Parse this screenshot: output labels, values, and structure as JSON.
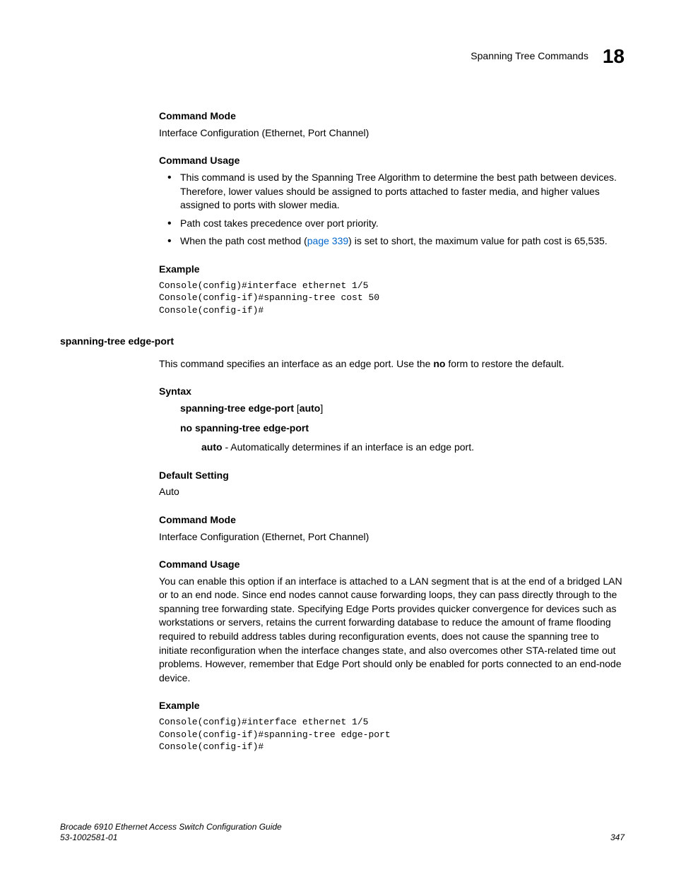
{
  "header": {
    "title": "Spanning Tree Commands",
    "chapter": "18"
  },
  "section1": {
    "h_mode": "Command Mode",
    "mode_text": "Interface Configuration (Ethernet, Port Channel)",
    "h_usage": "Command Usage",
    "usage_b1": "This command is used by the Spanning Tree Algorithm to determine the best path between devices. Therefore, lower values should be assigned to ports attached to faster media, and higher values assigned to ports with slower media.",
    "usage_b2": "Path cost takes precedence over port priority.",
    "usage_b3_a": "When the path cost method (",
    "usage_b3_link": "page 339",
    "usage_b3_b": ") is set to short, the maximum value for path cost is 65,535.",
    "h_example": "Example",
    "example_code": "Console(config)#interface ethernet 1/5\nConsole(config-if)#spanning-tree cost 50\nConsole(config-if)#"
  },
  "command2": {
    "title": "spanning-tree edge-port",
    "intro_a": "This command specifies an interface as an edge port. Use the ",
    "intro_bold": "no",
    "intro_b": " form to restore the default.",
    "h_syntax": "Syntax",
    "syntax_l1_bold": "spanning-tree edge-port",
    "syntax_l1_rest": " [",
    "syntax_l1_bold2": "auto",
    "syntax_l1_rest2": "]",
    "syntax_l2": "no spanning-tree edge-port",
    "syntax_param_bold": "auto",
    "syntax_param_rest": " - Automatically determines if an interface is an edge port.",
    "h_default": "Default Setting",
    "default_text": "Auto",
    "h_mode": "Command Mode",
    "mode_text": "Interface Configuration (Ethernet, Port Channel)",
    "h_usage": "Command Usage",
    "usage_text": "You can enable this option if an interface is attached to a LAN segment that is at the end of a bridged LAN or to an end node. Since end nodes cannot cause forwarding loops, they can pass directly through to the spanning tree forwarding state. Specifying Edge Ports provides quicker convergence for devices such as workstations or servers, retains the current forwarding database to reduce the amount of frame flooding required to rebuild address tables during reconfiguration events, does not cause the spanning tree to initiate reconfiguration when the interface changes state, and also overcomes other STA-related time out problems. However, remember that Edge Port should only be enabled for ports connected to an end-node device.",
    "h_example": "Example",
    "example_code": "Console(config)#interface ethernet 1/5\nConsole(config-if)#spanning-tree edge-port\nConsole(config-if)#"
  },
  "footer": {
    "guide": "Brocade 6910 Ethernet Access Switch Configuration Guide",
    "docnum": "53-1002581-01",
    "page": "347"
  }
}
